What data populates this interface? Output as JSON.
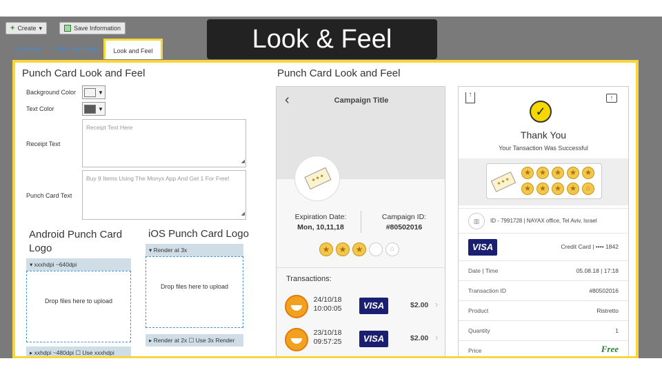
{
  "banner_title": "Look & Feel",
  "toolbar": {
    "create_label": "Create",
    "save_label": "Save Information"
  },
  "tabs": [
    {
      "label": "Campaign"
    },
    {
      "label": "Rules and Limits"
    },
    {
      "label": "Look and Feel"
    }
  ],
  "form": {
    "title": "Punch Card Look and Feel",
    "background_color_label": "Background Color",
    "background_color_value": "#f4f4f4",
    "text_color_label": "Text Color",
    "text_color_value": "#5a5a5a",
    "receipt_text_label": "Receipt Text",
    "receipt_text_placeholder": "Receipt Text Here",
    "punch_card_text_label": "Punch Card Text",
    "punch_card_text_placeholder": "Buy 9 Items Using The Monyx App And Get 1 For Free!"
  },
  "android_logo": {
    "title": "Android Punch Card Logo",
    "bar1": "xxxhdpi ~640dpi",
    "drop_text": "Drop files here to upload",
    "bar2": "xxhdpi ~480dpi",
    "bar2_checkbox": "Use xxxhdpi"
  },
  "ios_logo": {
    "title": "iOS Punch Card Logo",
    "bar1": "Render at 3x",
    "drop_text": "Drop files here to upload",
    "bar2": "Render at 2x",
    "bar2_checkbox": "Use 3x Render"
  },
  "preview": {
    "title": "Punch Card Look and Feel",
    "campaign_title": "Campaign Title",
    "expiration_label": "Expiration Date:",
    "expiration_value": "Mon, 10,11,18",
    "campaign_id_label": "Campaign ID:",
    "campaign_id_value": "#80502016",
    "transactions_label": "Transactions:",
    "transactions": [
      {
        "date": "24/10/18",
        "time": "10:00:05",
        "card": "VISA",
        "amount": "$2.00"
      },
      {
        "date": "23/10/18",
        "time": "09:57:25",
        "card": "VISA",
        "amount": "$2.00"
      }
    ]
  },
  "receipt": {
    "thank_you": "Thank You",
    "subtitle": "Your Tansaction Was Successful",
    "location": "ID - 7991728 | NAYAX office, Tel Aviv, Israel",
    "card_label": "Credit Card | •••• 1842",
    "card_brand": "VISA",
    "rows": [
      {
        "k": "Date | Time",
        "v": "05.08.18 | 17:18"
      },
      {
        "k": "Transaction ID",
        "v": "#80502016"
      },
      {
        "k": "Product",
        "v": "Ristretto"
      },
      {
        "k": "Quantity",
        "v": "1"
      },
      {
        "k": "Price",
        "v": "Free"
      }
    ]
  },
  "colors": {
    "accent_frame": "#f7d63c",
    "star": "#f4c64e",
    "visa": "#1a1f71",
    "success": "#f5d800"
  }
}
